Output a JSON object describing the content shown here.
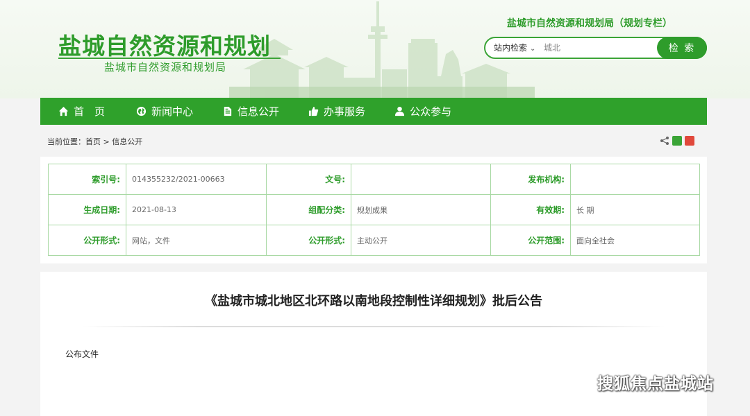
{
  "header": {
    "site_title": "盐城自然资源和规划",
    "site_subtitle": "盐城市自然资源和规划局",
    "column_title": "盐城市自然资源和规划局（规划专栏）",
    "search": {
      "scope_label": "站内检索",
      "placeholder": "城北",
      "button_label": "检 索"
    },
    "accent_color": "#2e9c2b"
  },
  "nav": {
    "items": [
      {
        "label": "首　页",
        "icon": "home-icon"
      },
      {
        "label": "新闻中心",
        "icon": "globe-icon"
      },
      {
        "label": "信息公开",
        "icon": "document-icon"
      },
      {
        "label": "办事服务",
        "icon": "thumbs-up-icon"
      },
      {
        "label": "公众参与",
        "icon": "user-icon"
      }
    ]
  },
  "breadcrumb": {
    "text": "当前位置：首页 > 信息公开"
  },
  "meta": {
    "rows": [
      [
        {
          "label": "索引号:",
          "value": "014355232/2021-00663"
        },
        {
          "label": "文号:",
          "value": ""
        },
        {
          "label": "发布机构:",
          "value": ""
        }
      ],
      [
        {
          "label": "生成日期:",
          "value": "2021-08-13"
        },
        {
          "label": "组配分类:",
          "value": "规划成果"
        },
        {
          "label": "有效期:",
          "value": "长 期"
        }
      ],
      [
        {
          "label": "公开形式:",
          "value": "网站，文件"
        },
        {
          "label": "公开形式:",
          "value": "主动公开"
        },
        {
          "label": "公开范围:",
          "value": "面向全社会"
        }
      ]
    ]
  },
  "article": {
    "title": "《盐城市城北地区北环路以南地段控制性详细规划》批后公告",
    "body_label": "公布文件"
  },
  "watermark": {
    "text": "搜狐焦点盐城站"
  }
}
